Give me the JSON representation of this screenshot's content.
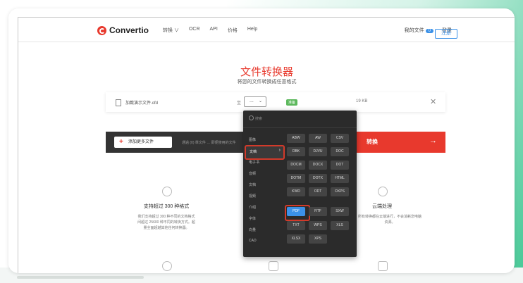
{
  "nav": {
    "logo_text": "Convertio",
    "menu": [
      "转换 ∨",
      "OCR",
      "API",
      "价格",
      "Help"
    ],
    "my_files": "我的文件",
    "my_files_count": "0",
    "login": "登录",
    "signup": "注册"
  },
  "hero": {
    "title": "文件转换器",
    "subtitle": "将您的文件转换成任意格式"
  },
  "file_row": {
    "file_name": "加載演示文件.ofd",
    "to_label": "至",
    "selected_format": "...",
    "status": "准备",
    "size": "19 KB"
  },
  "action_bar": {
    "add_more": "添加更多文件",
    "hint": "通過 (0) 單文件 … 即便使用的文件",
    "convert": "转换",
    "convert_arrow": "→"
  },
  "features": [
    {
      "title": "支持超过 300 种格式",
      "desc": [
        "我们支持超过 300 种不同的文档格式",
        "间超过 25600 种不同的转换方式。超",
        "量全面超越其他任何转换器。"
      ]
    },
    {
      "title": "云端处理",
      "desc": [
        "所有转换都在云端进行，不会消耗您电脑",
        "资源。"
      ]
    }
  ],
  "dropdown": {
    "search_placeholder": "搜索",
    "categories": [
      "图像",
      "文档",
      "电子书",
      "音频",
      "文档",
      "视频",
      "介绍",
      "字体",
      "向量",
      "CAD"
    ],
    "selected_category": "文档",
    "formats": [
      [
        "ABW",
        "AW",
        "CSV"
      ],
      [
        "DBK",
        "DJVU",
        "DOC"
      ],
      [
        "DOCM",
        "DOCX",
        "DOT"
      ],
      [
        "DOTM",
        "DOTX",
        "HTML"
      ],
      [
        "KWD",
        "ODT",
        "OXPS"
      ],
      [
        "PDF",
        "RTF",
        "SXW"
      ],
      [
        "TXT",
        "WPS",
        "XLS"
      ],
      [
        "XLSX",
        "XPS"
      ]
    ],
    "selected_format": "PDF"
  },
  "colors": {
    "accent": "#e8392d",
    "link": "#3b91e8",
    "dropdown_bg": "#2b2b2b",
    "highlight_ring": "#d23a2a"
  }
}
